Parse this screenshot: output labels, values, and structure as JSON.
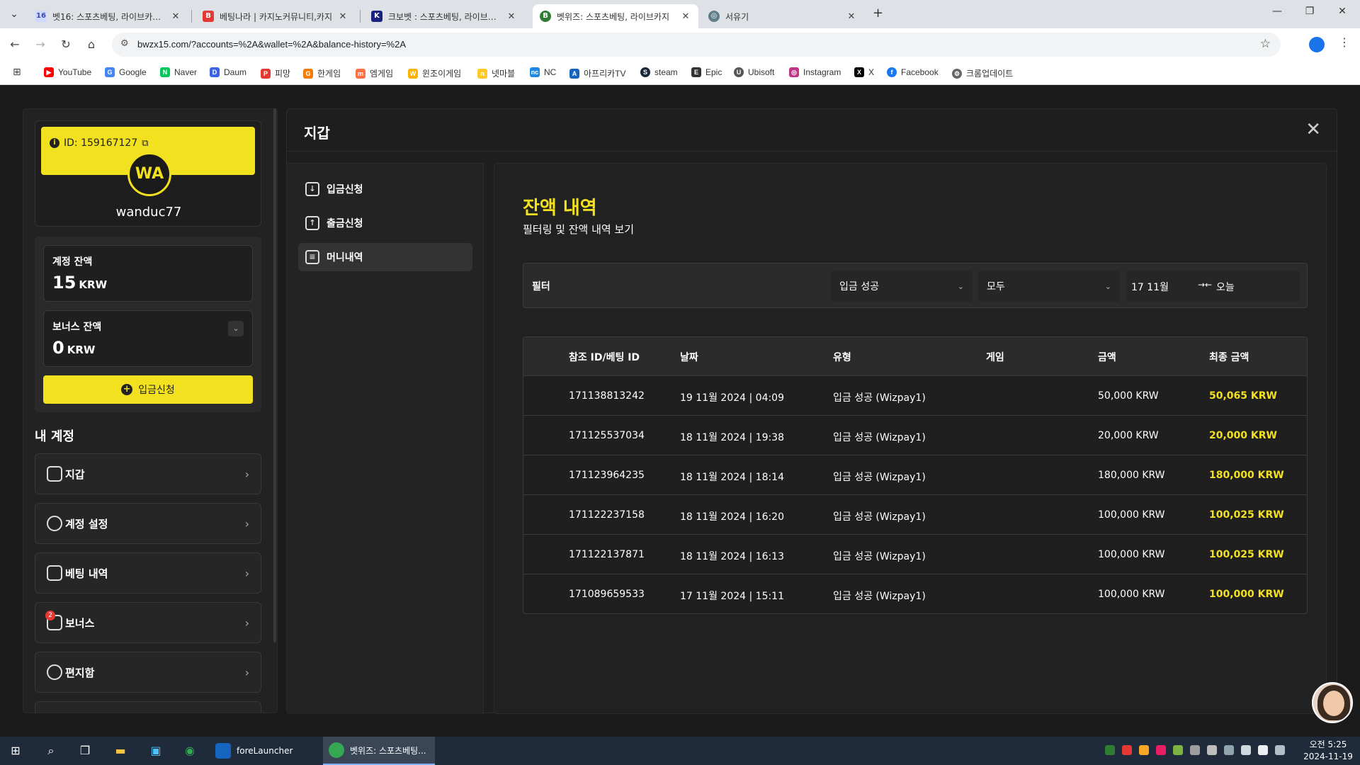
{
  "browser": {
    "tabs": [
      {
        "title": "벳16: 스포츠베팅, 라이브카지노",
        "color": "#cfd8ff",
        "glyph": "16"
      },
      {
        "title": "베팅나라 | 카지노커뮤니티,카지",
        "color": "#e53935",
        "glyph": "B"
      },
      {
        "title": "크보벳 : 스포츠베팅, 라이브카지",
        "color": "#1a237e",
        "glyph": "K"
      },
      {
        "title": "벳위즈: 스포츠베팅, 라이브카지",
        "color": "#2e7d32",
        "glyph": "B"
      },
      {
        "title": "서유기",
        "color": "#607d8b",
        "glyph": "◎"
      }
    ],
    "url": "bwzx15.com/?accounts=%2A&wallet=%2A&balance-history=%2A",
    "bookmarks": [
      {
        "label": "YouTube",
        "color": "#ff0000"
      },
      {
        "label": "Google",
        "color": "#4285f4"
      },
      {
        "label": "Naver",
        "color": "#03c75a"
      },
      {
        "label": "Daum",
        "color": "#3c62e8"
      },
      {
        "label": "피망",
        "color": "#e53935"
      },
      {
        "label": "한게임",
        "color": "#f57c00"
      },
      {
        "label": "엠게임",
        "color": "#ff7043"
      },
      {
        "label": "윈조이게임",
        "color": "#ffb300"
      },
      {
        "label": "넷마블",
        "color": "#ffca28"
      },
      {
        "label": "NC",
        "color": "#1e88e5"
      },
      {
        "label": "아프리카TV",
        "color": "#1565c0"
      },
      {
        "label": "steam",
        "color": "#1b2838"
      },
      {
        "label": "Epic",
        "color": "#333333"
      },
      {
        "label": "Ubisoft",
        "color": "#555555"
      },
      {
        "label": "Instagram",
        "color": "#c13584"
      },
      {
        "label": "X",
        "color": "#000000"
      },
      {
        "label": "Facebook",
        "color": "#1877f2"
      },
      {
        "label": "크롬업데이트",
        "color": "#666666"
      }
    ]
  },
  "sidebar": {
    "user_id": "ID: 159167127",
    "avatar_initials": "WA",
    "username": "wanduc77",
    "account_balance_label": "계정 잔액",
    "account_balance_value": "15",
    "account_balance_currency": "KRW",
    "bonus_balance_label": "보너스 잔액",
    "bonus_balance_value": "0",
    "bonus_balance_currency": "KRW",
    "deposit_button": "입금신청",
    "my_account_title": "내 계정",
    "menu": [
      {
        "label": "지갑"
      },
      {
        "label": "계정 설정"
      },
      {
        "label": "베팅 내역"
      },
      {
        "label": "보너스",
        "badge": "2"
      },
      {
        "label": "편지함"
      }
    ]
  },
  "wallet": {
    "title": "지갑",
    "nav": [
      {
        "label": "입금신청"
      },
      {
        "label": "출금신청"
      },
      {
        "label": "머니내역"
      }
    ],
    "content": {
      "title": "잔액 내역",
      "subtitle": "필터링 및 잔액 내역 보기",
      "filter_label": "필터",
      "filter_type": "입금 성공",
      "filter_scope": "모두",
      "date_from": "17 11월",
      "date_to": "오늘",
      "columns": [
        "참조 ID/베팅 ID",
        "날짜",
        "유형",
        "게임",
        "금액",
        "최종 금액"
      ],
      "rows": [
        {
          "ref": "171138813242",
          "date": "19 11월 2024 | 04:09",
          "type": "입금 성공 (Wizpay1)",
          "game": "",
          "amount": "50,000 KRW",
          "final": "50,065 KRW"
        },
        {
          "ref": "171125537034",
          "date": "18 11월 2024 | 19:38",
          "type": "입금 성공 (Wizpay1)",
          "game": "",
          "amount": "20,000 KRW",
          "final": "20,000 KRW"
        },
        {
          "ref": "171123964235",
          "date": "18 11월 2024 | 18:14",
          "type": "입금 성공 (Wizpay1)",
          "game": "",
          "amount": "180,000 KRW",
          "final": "180,000 KRW"
        },
        {
          "ref": "171122237158",
          "date": "18 11월 2024 | 16:20",
          "type": "입금 성공 (Wizpay1)",
          "game": "",
          "amount": "100,000 KRW",
          "final": "100,025 KRW"
        },
        {
          "ref": "171122137871",
          "date": "18 11월 2024 | 16:13",
          "type": "입금 성공 (Wizpay1)",
          "game": "",
          "amount": "100,000 KRW",
          "final": "100,025 KRW"
        },
        {
          "ref": "171089659533",
          "date": "17 11월 2024 | 15:11",
          "type": "입금 성공 (Wizpay1)",
          "game": "",
          "amount": "100,000 KRW",
          "final": "100,000 KRW"
        }
      ]
    }
  },
  "taskbar": {
    "apps": [
      {
        "label": "foreLauncher"
      },
      {
        "label": "벳위즈: 스포츠베팅..."
      }
    ],
    "time": "오전 5:25",
    "date": "2024-11-19"
  },
  "colors": {
    "accent": "#f2e11f",
    "background": "#1b1b1b"
  }
}
